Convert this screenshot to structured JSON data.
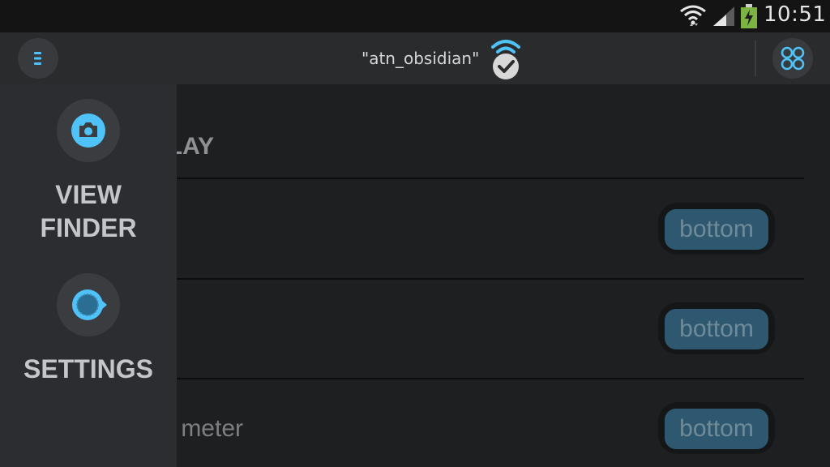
{
  "status_bar": {
    "time": "10:51",
    "icons": [
      "wifi-icon",
      "signal-icon",
      "battery-charging-icon"
    ],
    "battery_color": "#8bc34a"
  },
  "action_bar": {
    "menu_icon": "menu-icon",
    "ssid": "\"atn_obsidian\"",
    "connection_icon": "wifi-connected-check-icon",
    "apps_icon": "grid-circles-icon",
    "accent_color": "#4fc3f7"
  },
  "content": {
    "section_title": "LAY",
    "rows": [
      {
        "label": "",
        "value": "bottom"
      },
      {
        "label": "",
        "value": "bottom"
      },
      {
        "label": "meter",
        "value": "bottom"
      }
    ]
  },
  "drawer": {
    "items": [
      {
        "label_line1": "VIEW",
        "label_line2": "FINDER",
        "icon": "camera-icon"
      },
      {
        "label": "SETTINGS",
        "icon": "settings-icon"
      }
    ]
  }
}
